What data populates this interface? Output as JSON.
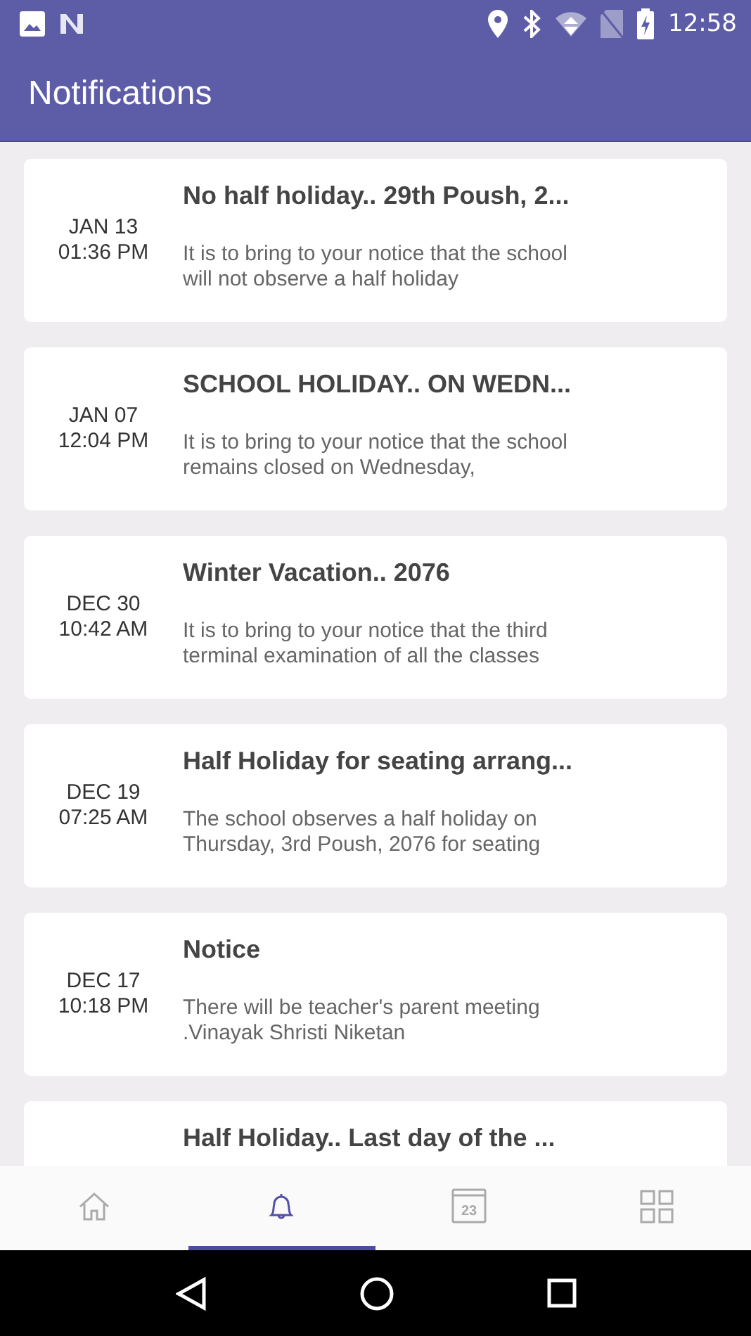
{
  "status_bar": {
    "time": "12:58"
  },
  "app_bar": {
    "title": "Notifications"
  },
  "notifications": [
    {
      "date": "JAN 13",
      "time": "01:36 PM",
      "title": "No half holiday.. 29th Poush, 2...",
      "body": "It is to bring to your notice that the school will not observe a half holiday"
    },
    {
      "date": "JAN 07",
      "time": "12:04 PM",
      "title": "SCHOOL HOLIDAY.. ON WEDN...",
      "body": "It is to bring to your notice that the school remains closed on Wednesday,"
    },
    {
      "date": "DEC 30",
      "time": "10:42 AM",
      "title": "Winter Vacation.. 2076",
      "body": "It is to bring to your notice that the third terminal examination of all the classes"
    },
    {
      "date": "DEC 19",
      "time": "07:25 AM",
      "title": "Half Holiday for seating arrang...",
      "body": "The school observes a half holiday on Thursday, 3rd Poush, 2076 for seating"
    },
    {
      "date": "DEC 17",
      "time": "10:18 PM",
      "title": "Notice",
      "body": "There will be teacher's  parent meeting .Vinayak Shristi Niketan"
    },
    {
      "title": "Half Holiday.. Last day of the ..."
    }
  ],
  "bottom_nav": [
    {
      "kind": "home",
      "selected": false
    },
    {
      "kind": "bell",
      "selected": true
    },
    {
      "kind": "calendar",
      "selected": false,
      "icon_text": "23"
    },
    {
      "kind": "grid",
      "selected": false
    }
  ]
}
